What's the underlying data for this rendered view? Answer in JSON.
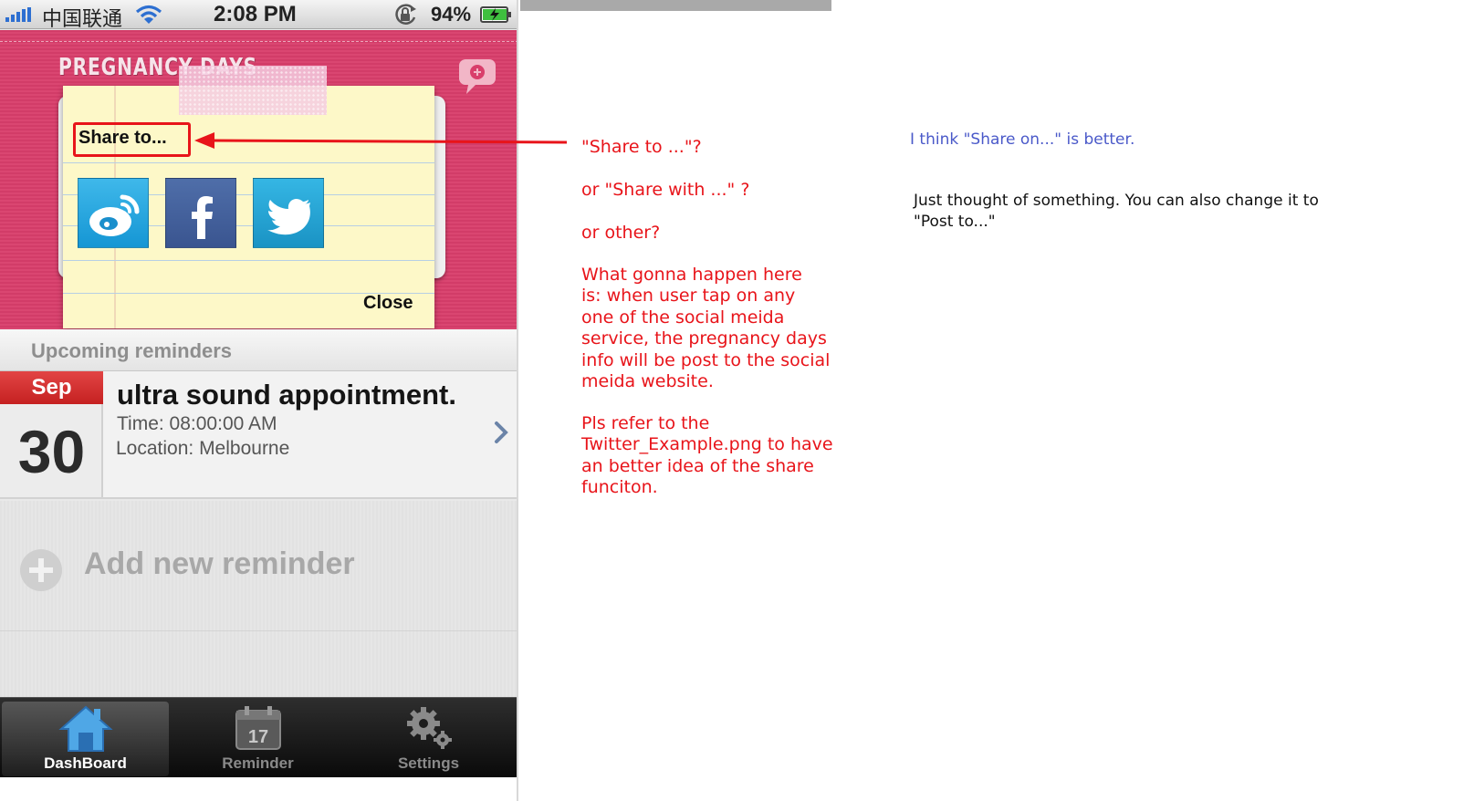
{
  "status_bar": {
    "carrier": "中国联通",
    "time": "2:08 PM",
    "battery": "94%"
  },
  "header": {
    "logo": "PREGNANCY DAYS",
    "add_icon": "speech-bubble-plus-icon"
  },
  "share_popup": {
    "title": "Share to...",
    "services": [
      {
        "name": "weibo",
        "icon": "weibo-icon",
        "color": "#2aa3dd"
      },
      {
        "name": "facebook",
        "icon": "facebook-icon",
        "color": "#3b5998"
      },
      {
        "name": "twitter",
        "icon": "twitter-icon",
        "color": "#1fa1d3"
      }
    ],
    "close_label": "Close"
  },
  "reminders": {
    "heading": "Upcoming reminders",
    "items": [
      {
        "month": "Sep",
        "day": "30",
        "title": "ultra sound appointment.",
        "time": "Time: 08:00:00 AM",
        "location": "Location: Melbourne"
      }
    ],
    "add_label": "Add new reminder"
  },
  "tabbar": {
    "tabs": [
      {
        "label": "DashBoard",
        "icon": "home-icon",
        "active": true
      },
      {
        "label": "Reminder",
        "icon": "calendar-icon",
        "active": false,
        "icon_text": "17"
      },
      {
        "label": "Settings",
        "icon": "gear-icon",
        "active": false
      }
    ]
  },
  "annotations": {
    "red": [
      "\"Share to ...\"?",
      "or \"Share with ...\" ?",
      "or other?",
      "What gonna happen here\nis: when user tap on any\none of the social meida\nservice, the pregnancy days\ninfo will be post to the social\nmeida website.",
      "Pls refer to the\nTwitter_Example.png to have\nan better idea of the share\nfunciton."
    ],
    "blue": "I think \"Share on...\" is better.",
    "black": "Just thought of something. You can also change it to\n\"Post to...\""
  },
  "colors": {
    "header_pink": "#d93e6b",
    "note_yellow": "#fdf8c8",
    "annotation_red": "#e8141a",
    "annotation_blue": "#4a59c9",
    "month_red": "#d23232"
  }
}
